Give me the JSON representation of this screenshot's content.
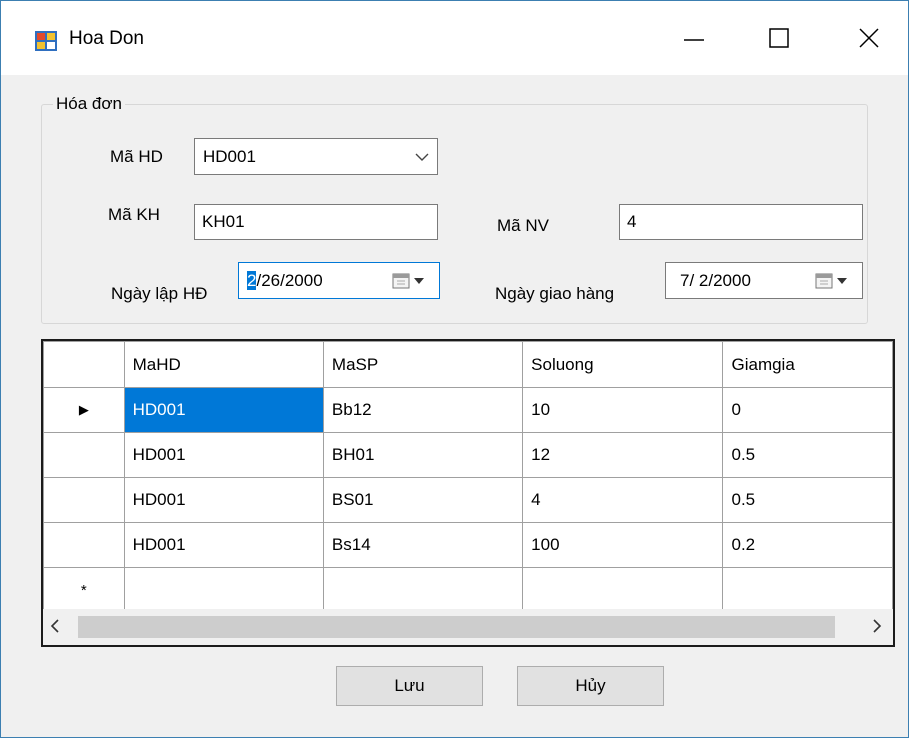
{
  "window": {
    "title": "Hoa Don",
    "icon": "app-form-icon",
    "controls": [
      "minimize-icon",
      "maximize-icon",
      "close-icon"
    ]
  },
  "group": {
    "label": "Hóa đơn",
    "ma_hd": {
      "label": "Mã HD",
      "value": "HD001"
    },
    "ma_kh": {
      "label": "Mã KH",
      "value": "KH01"
    },
    "ma_nv": {
      "label": "Mã NV",
      "value": "4"
    },
    "ngay_lap": {
      "label": "Ngày lập HĐ",
      "selected_part": "2",
      "rest": "/26/2000"
    },
    "ngay_giao": {
      "label": "Ngày giao hàng",
      "value": "7/ 2/2000"
    }
  },
  "grid": {
    "columns": [
      "MaHD",
      "MaSP",
      "Soluong",
      "Giamgia"
    ],
    "rows": [
      [
        "HD001",
        "Bb12",
        "10",
        "0"
      ],
      [
        "HD001",
        "BH01",
        "12",
        "0.5"
      ],
      [
        "HD001",
        "BS01",
        "4",
        "0.5"
      ],
      [
        "HD001",
        "Bs14",
        "100",
        "0.2"
      ]
    ],
    "current_row_marker": "▶",
    "new_row_marker": "*"
  },
  "buttons": {
    "save": "Lưu",
    "cancel": "Hủy"
  },
  "colors": {
    "selection": "#0078d7",
    "window_border": "#3c7fb1",
    "surface": "#f0f0f0"
  }
}
